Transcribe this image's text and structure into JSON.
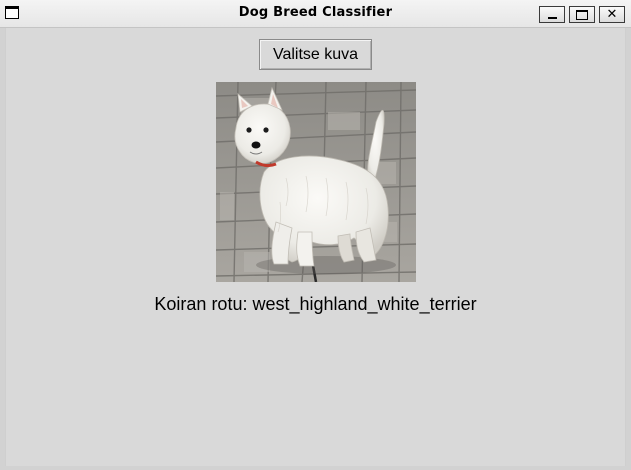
{
  "window": {
    "title": "Dog Breed Classifier",
    "icons": [
      "window-icon",
      "minimize-icon",
      "maximize-icon",
      "close-icon"
    ]
  },
  "main": {
    "choose_button_label": "Valitse kuva",
    "image_alt": "dog photo",
    "result_text": "Koiran rotu: west_highland_white_terrier"
  },
  "colors": {
    "background": "#d9d9d9",
    "titlebar": "#ececec",
    "text": "#000000"
  }
}
